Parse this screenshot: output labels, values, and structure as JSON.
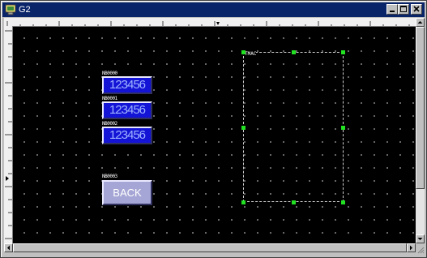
{
  "window": {
    "title": "G2",
    "icon": "app-icon"
  },
  "title_buttons": [
    "minimize",
    "maximize",
    "close"
  ],
  "parts": [
    {
      "kind": "numeric-display",
      "tag": "NB0000",
      "value": "123456"
    },
    {
      "kind": "numeric-display",
      "tag": "NB0001",
      "value": "123456"
    },
    {
      "kind": "numeric-display",
      "tag": "NB0002",
      "value": "123456"
    },
    {
      "kind": "button",
      "tag": "NB0003",
      "label": "BACK"
    }
  ],
  "selection": {
    "tag": "TMAC"
  },
  "colors": {
    "canvas": "#000000",
    "grid_dot": "#7a7a7a",
    "numeric_fill": "#1414d6",
    "numeric_text": "#9fb6ff",
    "button_fill": "#a6a6d6",
    "handle": "#22e022",
    "titlebar": "#0a246a"
  },
  "icons": [
    "app-icon",
    "minimize-icon",
    "maximize-icon",
    "close-icon",
    "scroll-up-icon",
    "scroll-down-icon",
    "scroll-left-icon",
    "scroll-right-icon",
    "resize-grip-icon"
  ]
}
